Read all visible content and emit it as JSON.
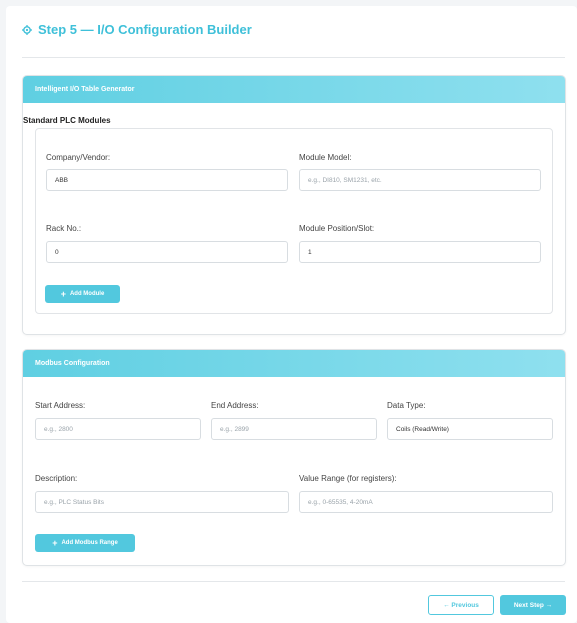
{
  "header": {
    "title": "Step 5 — I/O Configuration Builder",
    "icon": "gear-icon",
    "accent_color": "#3fc0d9"
  },
  "plc_panel": {
    "header": "Intelligent I/O Table Generator",
    "section_title": "Standard PLC Modules",
    "vendor_label": "Company/Vendor:",
    "vendor_value": "ABB",
    "model_label": "Module Model:",
    "model_placeholder": "e.g., DI810, SM1231, etc.",
    "rack_label": "Rack No.:",
    "rack_value": "0",
    "slot_label": "Module Position/Slot:",
    "slot_value": "1",
    "add_button": "Add Module"
  },
  "modbus_panel": {
    "header": "Modbus Configuration",
    "start_label": "Start Address:",
    "start_placeholder": "e.g., 2800",
    "end_label": "End Address:",
    "end_placeholder": "e.g., 2899",
    "type_label": "Data Type:",
    "type_value": "Coils (Read/Write)",
    "desc_label": "Description:",
    "desc_placeholder": "e.g., PLC Status Bits",
    "range_label": "Value Range (for registers):",
    "range_placeholder": "e.g., 0-65535, 4-20mA",
    "add_button": "Add Modbus Range"
  },
  "footer": {
    "previous": "← Previous",
    "next": "Next Step →"
  }
}
